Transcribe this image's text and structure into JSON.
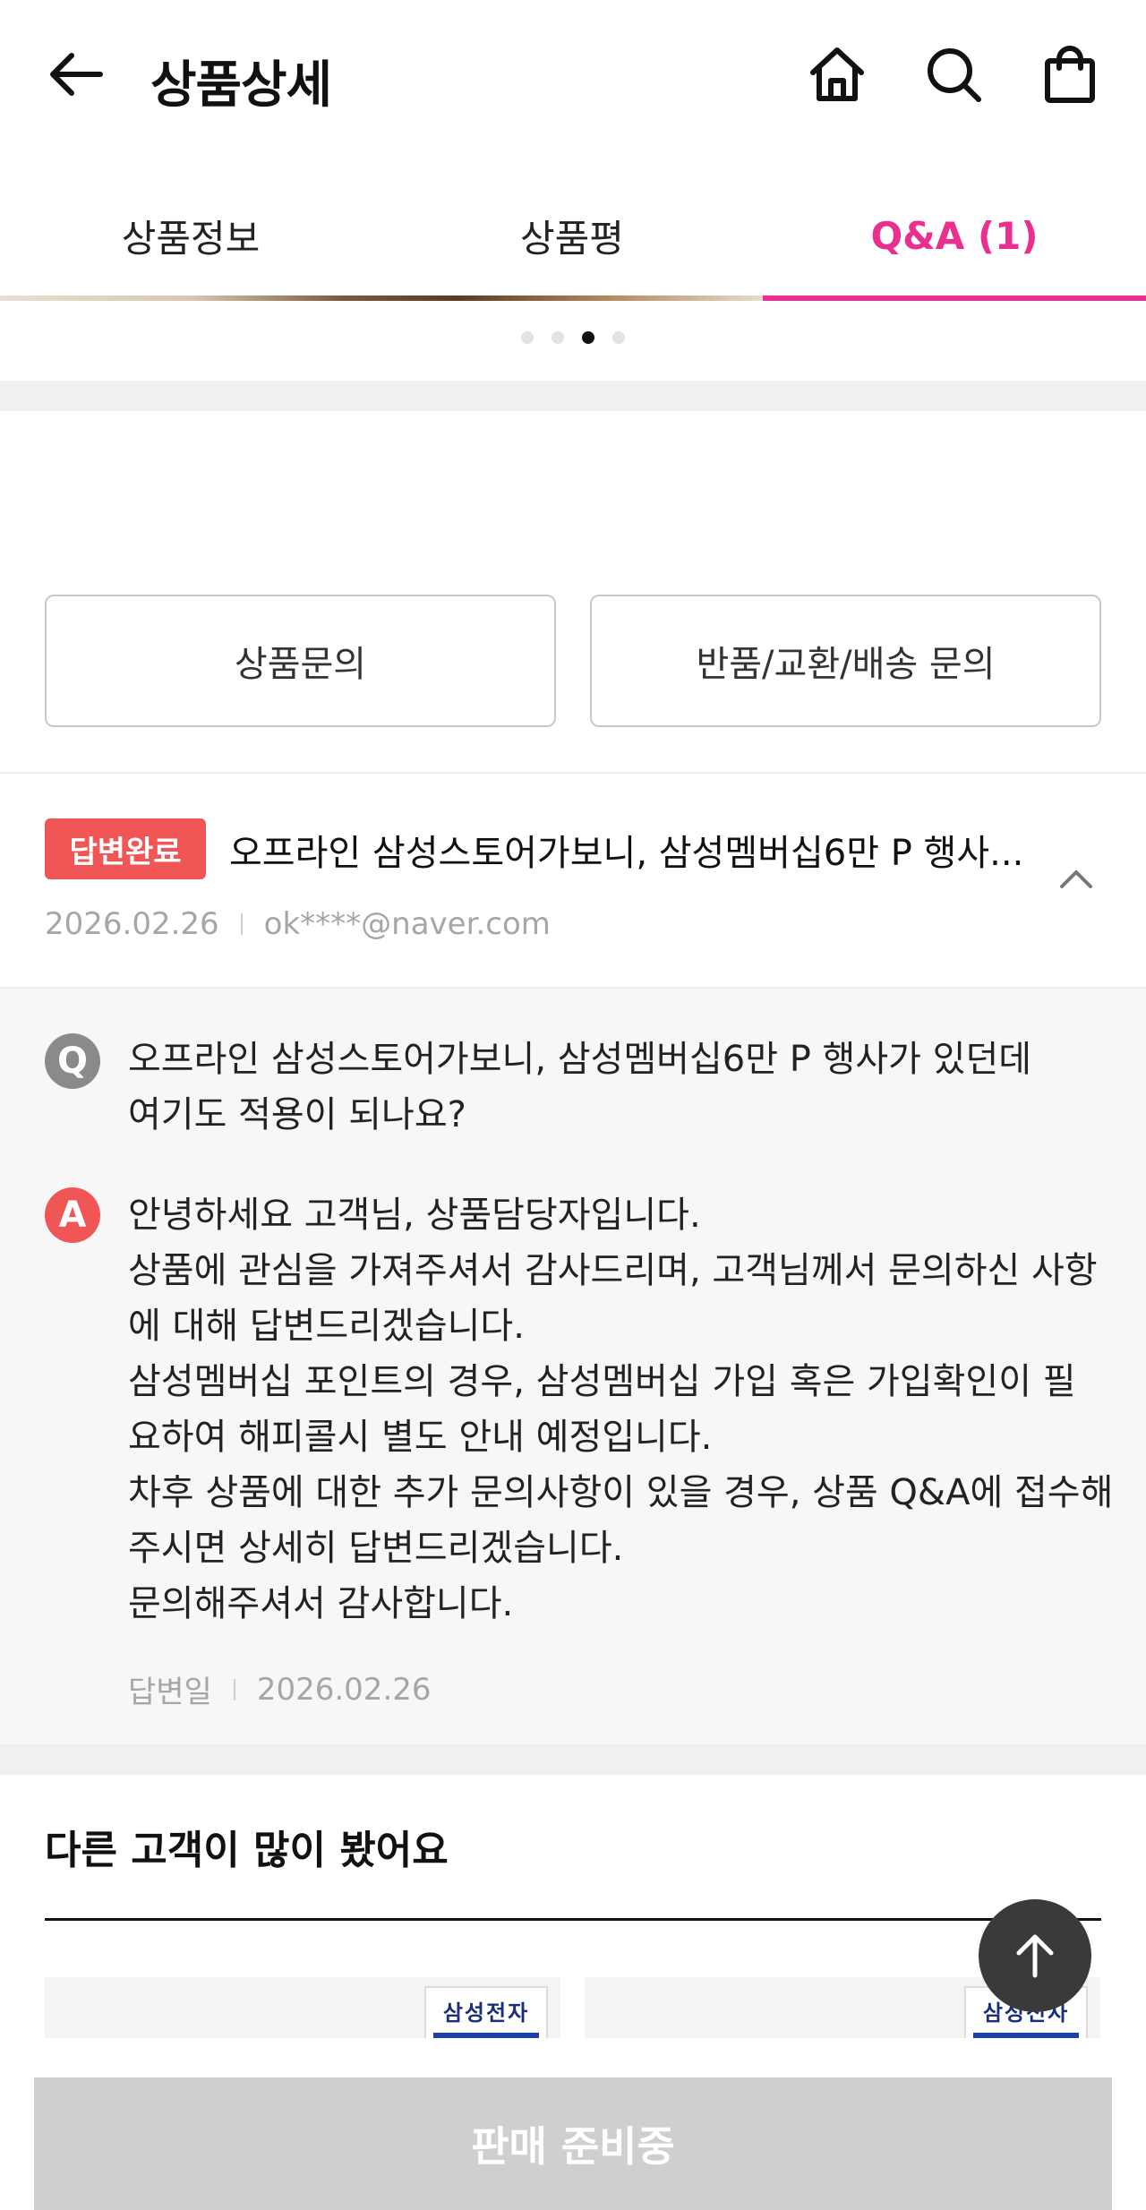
{
  "header": {
    "title": "상품상세",
    "icons": [
      "back-arrow-icon",
      "home-icon",
      "search-icon",
      "shopping-bag-icon"
    ]
  },
  "tabs": [
    {
      "label": "상품정보",
      "active": false
    },
    {
      "label": "상품평",
      "active": false
    },
    {
      "label": "Q&A (1)",
      "active": true
    }
  ],
  "carousel": {
    "count": 4,
    "active_index": 2
  },
  "inquiry_buttons": {
    "product": "상품문의",
    "return": "반품/교환/배송 문의"
  },
  "qa_item": {
    "status": "답변완료",
    "title": "오프라인 삼성스토어가보니, 삼성멤버십6만 P 행사...",
    "date": "2026.02.26",
    "author": "ok****@naver.com",
    "question_label": "Q",
    "question_lines": [
      "오프라인 삼성스토어가보니, 삼성멤버십6만 P 행사가 있던데",
      "여기도 적용이 되나요?"
    ],
    "answer_label": "A",
    "answer_lines": [
      "안녕하세요 고객님, 상품담당자입니다.",
      "상품에 관심을 가져주셔서 감사드리며, 고객님께서 문의하신 사항",
      "에 대해 답변드리겠습니다.",
      "삼성멤버십 포인트의 경우, 삼성멤버십 가입 혹은 가입확인이 필",
      "요하여 해피콜시 별도 안내 예정입니다.",
      "차후 상품에 대한 추가 문의사항이 있을 경우, 상품 Q&A에 접수해",
      "주시면 상세히 답변드리겠습니다.",
      "문의해주셔서 감사합니다."
    ],
    "answer_date_label": "답변일",
    "answer_date": "2026.02.26"
  },
  "recommendations": {
    "title": "다른 고객이 많이 봤어요",
    "cards": [
      {
        "brand_label": "삼성전자"
      },
      {
        "brand_label": "삼성전자"
      }
    ]
  },
  "bottom_bar": {
    "button_label": "판매 준비중"
  },
  "colors": {
    "accent_pink": "#e9308e",
    "badge_red": "#f05656",
    "disabled_gray": "#cfcfcf"
  }
}
